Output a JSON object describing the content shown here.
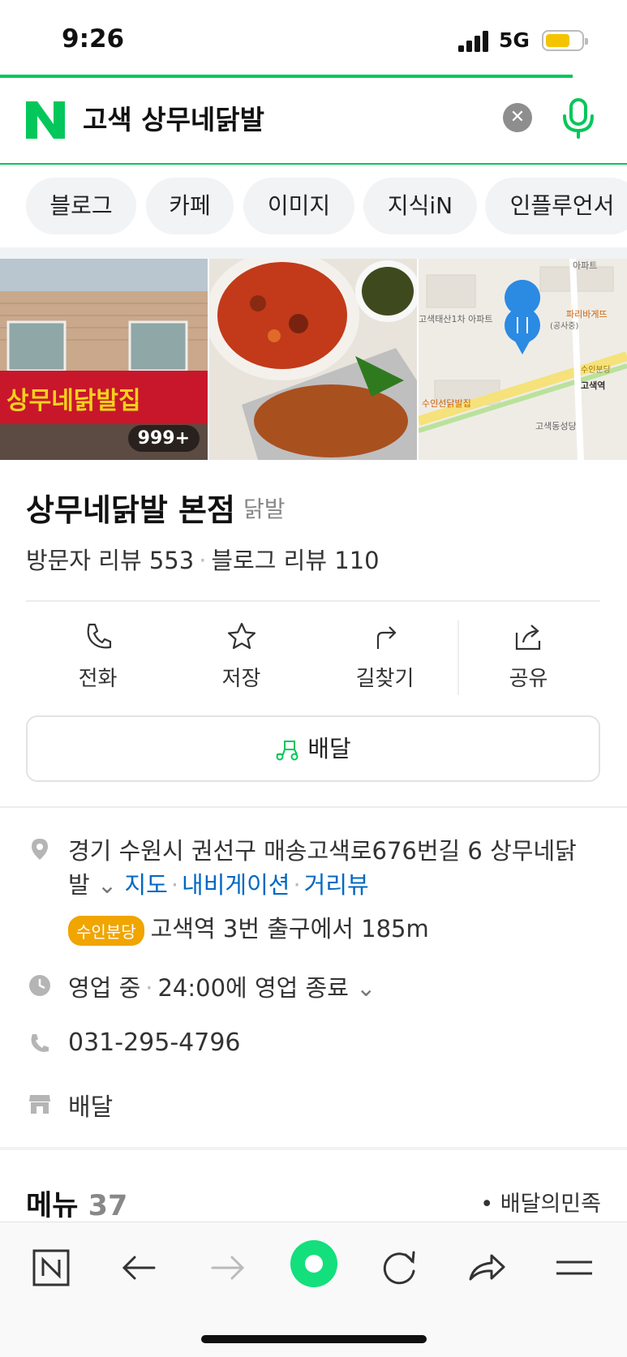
{
  "status_bar": {
    "time": "9:26",
    "network": "5G"
  },
  "search": {
    "query": "고색 상무네닭발",
    "clear_label": "✕"
  },
  "chips": [
    "블로그",
    "카페",
    "이미지",
    "지식iN",
    "인플루언서"
  ],
  "photos": {
    "count_badge": "999+",
    "sign_text": "상무네닭발집",
    "map_labels": [
      "아파트",
      "고색태산1차 아파트",
      "파리바게뜨",
      "(공사중)",
      "수인선닭발집",
      "수인분당",
      "고색역",
      "고색동성당"
    ]
  },
  "place": {
    "name": "상무네닭발 본점",
    "category": "닭발",
    "visitor_reviews": "방문자 리뷰 553",
    "blog_reviews": "블로그 리뷰 110"
  },
  "actions": {
    "call": "전화",
    "save": "저장",
    "directions": "길찾기",
    "share": "공유"
  },
  "delivery_button": "배달",
  "info": {
    "address_line1": "경기 수원시 권선구 매송고색로676번길 6 상무네닭",
    "address_line2": "발",
    "map_link": "지도",
    "nav_link": "내비게이션",
    "street_link": "거리뷰",
    "subway_tag": "수인분당",
    "subway_text": "고색역 3번 출구에서 185m",
    "hours_status": "영업 중",
    "hours_detail": "24:00에 영업 종료",
    "phone": "031-295-4796",
    "service": "배달"
  },
  "menu": {
    "title": "메뉴",
    "count": "37",
    "source": "• 배달의민족"
  },
  "colors": {
    "naver_green": "#03c75a",
    "link_blue": "#0068c3",
    "subway_tag": "#f0a500"
  }
}
